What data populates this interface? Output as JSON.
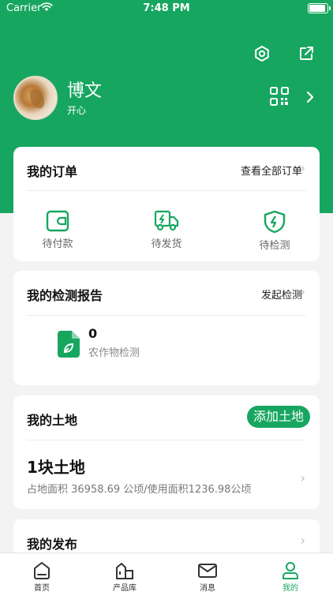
{
  "status_bar": {
    "carrier": "Carrier",
    "time": "7:48 PM"
  },
  "profile": {
    "name": "博文",
    "subtitle": "开心"
  },
  "orders": {
    "title": "我的订单",
    "view_all": "查看全部订单",
    "items": [
      {
        "label": "待付款",
        "icon": "wallet-icon"
      },
      {
        "label": "待发货",
        "icon": "truck-icon"
      },
      {
        "label": "待检测",
        "icon": "shield-bolt-icon"
      }
    ]
  },
  "reports": {
    "title": "我的检测报告",
    "action": "发起检测",
    "count": "0",
    "label": "农作物检测"
  },
  "land": {
    "title": "我的土地",
    "add_button": "添加土地",
    "count_label": "1块土地",
    "detail": "占地面积 36958.69 公顷/使用面积1236.98公顷"
  },
  "publish": {
    "title": "我的发布"
  },
  "tabbar": {
    "items": [
      {
        "label": "首页",
        "icon": "home-icon"
      },
      {
        "label": "产品库",
        "icon": "product-library-icon"
      },
      {
        "label": "消息",
        "icon": "mail-icon"
      },
      {
        "label": "我的",
        "icon": "person-icon"
      }
    ],
    "active_color": "#17a660"
  },
  "colors": {
    "brand": "#17a660",
    "background": "#f3f3f3"
  }
}
